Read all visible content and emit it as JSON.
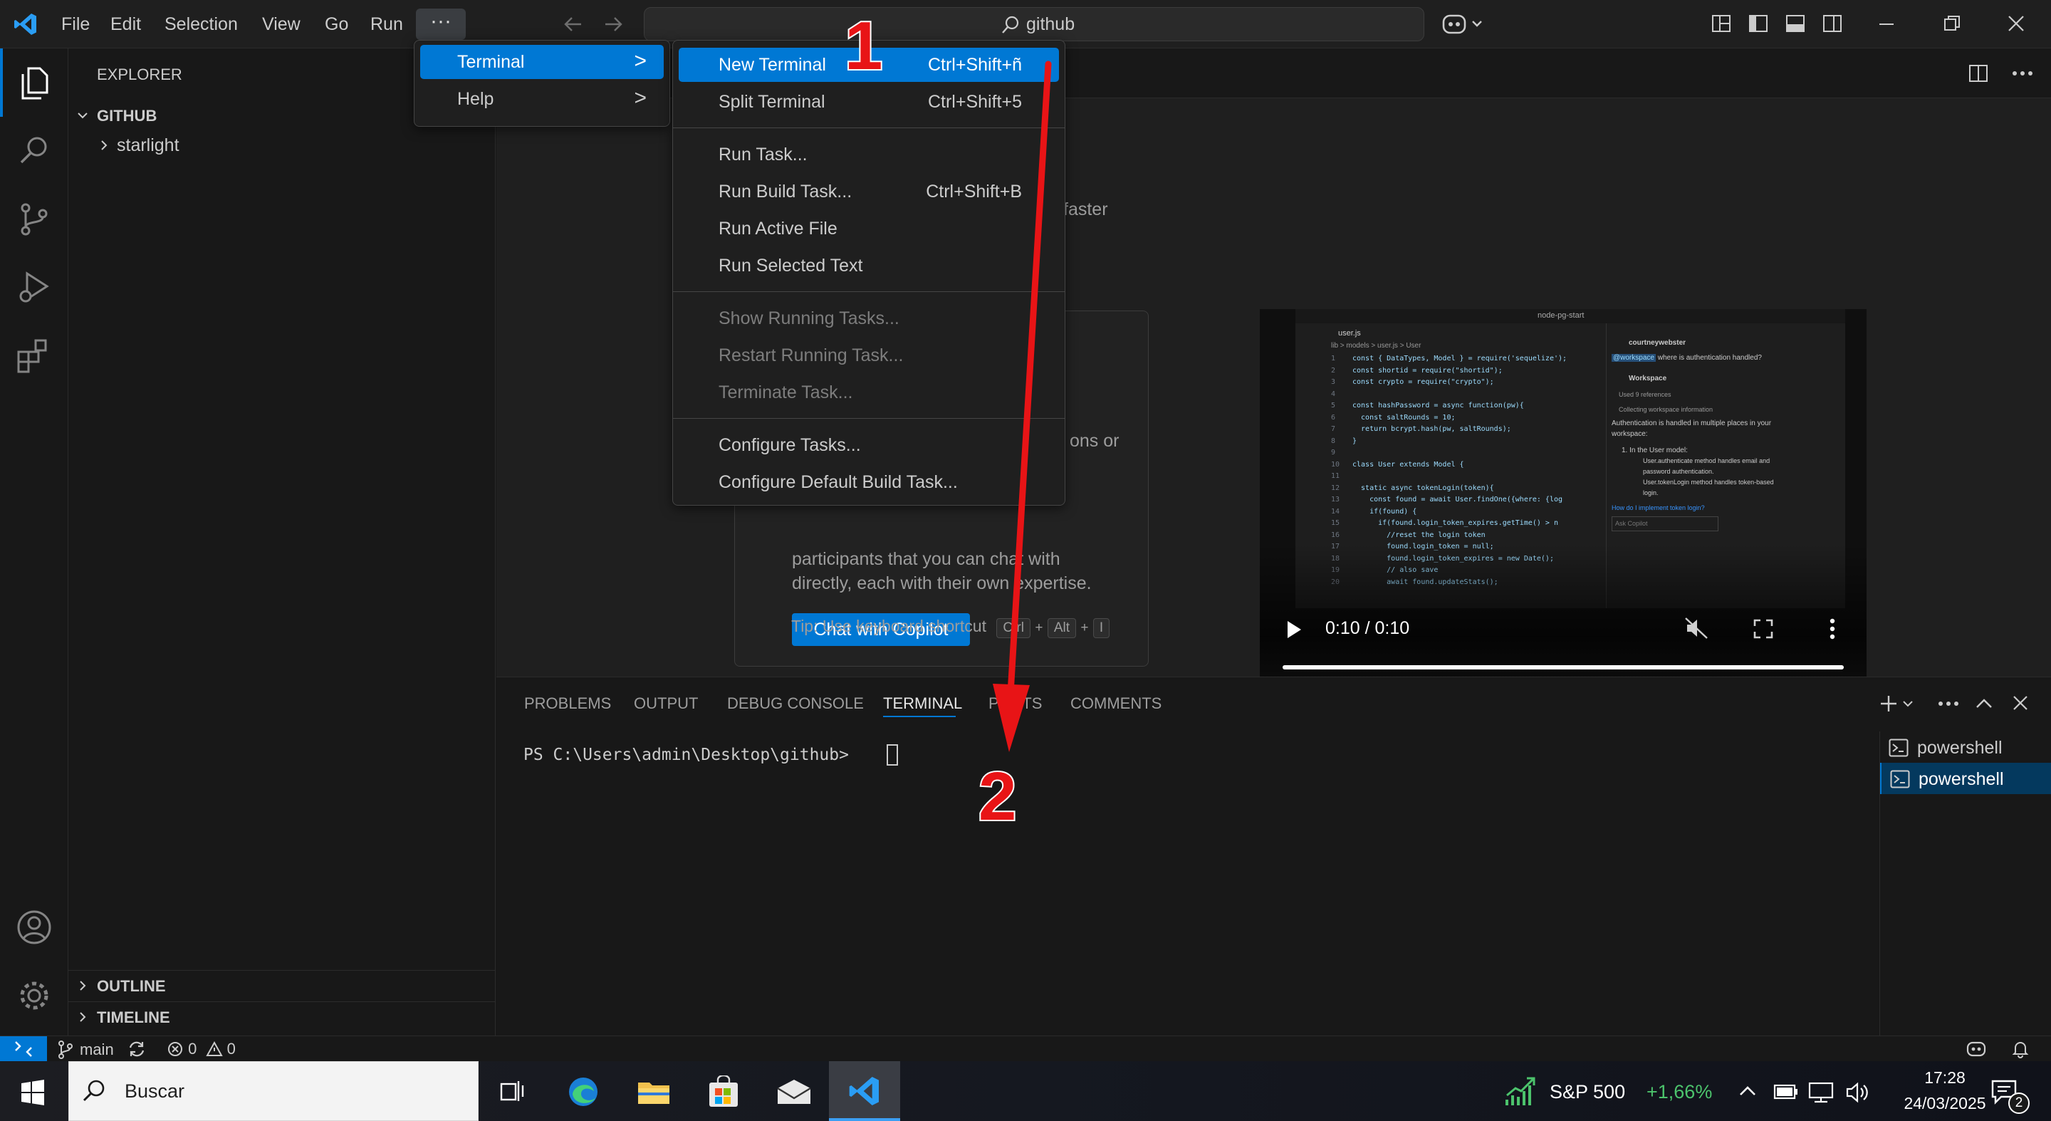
{
  "titlebar": {
    "menus": [
      "File",
      "Edit",
      "Selection",
      "View",
      "Go",
      "Run"
    ],
    "more_label": "···",
    "search_text": "github"
  },
  "sidebar": {
    "title": "EXPLORER",
    "folder": "GITHUB",
    "items": [
      "starlight"
    ],
    "outline": "OUTLINE",
    "timeline": "TIMELINE"
  },
  "top_menu": {
    "items": [
      {
        "label": "Terminal",
        "arrow": ">"
      },
      {
        "label": "Help",
        "arrow": ">"
      }
    ]
  },
  "terminal_menu": {
    "group1": [
      {
        "label": "New Terminal",
        "shortcut": "Ctrl+Shift+ñ"
      },
      {
        "label": "Split Terminal",
        "shortcut": "Ctrl+Shift+5"
      }
    ],
    "group2": [
      {
        "label": "Run Task...",
        "shortcut": ""
      },
      {
        "label": "Run Build Task...",
        "shortcut": "Ctrl+Shift+B"
      },
      {
        "label": "Run Active File",
        "shortcut": ""
      },
      {
        "label": "Run Selected Text",
        "shortcut": ""
      }
    ],
    "group3": [
      {
        "label": "Show Running Tasks..."
      },
      {
        "label": "Restart Running Task..."
      },
      {
        "label": "Terminate Task..."
      }
    ],
    "group4": [
      {
        "label": "Configure Tasks..."
      },
      {
        "label": "Configure Default Build Task..."
      }
    ]
  },
  "welcome": {
    "faster_fragment": "faster",
    "ons_or_fragment": "ons or",
    "participants_line1": "participants that you can chat with",
    "participants_line2": "directly, each with their own expertise.",
    "chat_button": "Chat with Copilot",
    "tip_text": "Tip: Use keyboard shortcut",
    "key1": "Ctrl",
    "plus1": "+",
    "key2": "Alt",
    "plus2": "+",
    "key3": "I"
  },
  "video": {
    "time": "0:10 / 0:10",
    "progress": 1.0,
    "thumb": {
      "search": "node-pg-start",
      "file_tab": "user.js",
      "breadcrumb": "lib > models > user.js > User",
      "code_lines": [
        "const { DataTypes, Model } = require('sequelize');",
        "const shortid = require(\"shortid\");",
        "const crypto = require(\"crypto\");",
        "",
        "const hashPassword = async function(pw){",
        "  const saltRounds = 10;",
        "  return bcrypt.hash(pw, saltRounds);",
        "}",
        "",
        "class User extends Model {",
        "",
        "  static async tokenLogin(token){",
        "    const found = await User.findOne({where: {log",
        "    if(found) {",
        "      if(found.login_token_expires.getTime() > n",
        "        //reset the login token",
        "        found.login_token = null;",
        "        found.login_token_expires = new Date();",
        "        // also save",
        "        await found.updateStats();"
      ],
      "chat_user": "courtneywebster",
      "chat_tag": "@workspace",
      "chat_question": "where is authentication handled?",
      "chat_section": "Workspace",
      "chat_refs": "Used 9 references",
      "chat_collect": "Collecting workspace information",
      "chat_answer1": "Authentication is handled in multiple places in your",
      "chat_answer2": "workspace:",
      "chat_point": "1. In the User model:",
      "chat_sub1": "User.authenticate method handles email and",
      "chat_sub1b": "password authentication.",
      "chat_sub2": "User.tokenLogin method handles token-based",
      "chat_sub2b": "login.",
      "chat_followup": "How do I implement token login?",
      "chat_input": "Ask Copilot"
    }
  },
  "panel": {
    "tabs": [
      "PROBLEMS",
      "OUTPUT",
      "DEBUG CONSOLE",
      "TERMINAL",
      "PORTS",
      "COMMENTS"
    ],
    "active_tab": "TERMINAL",
    "prompt": "PS C:\\Users\\admin\\Desktop\\github>",
    "terminals": [
      "powershell",
      "powershell"
    ]
  },
  "annotations": {
    "num1": "1",
    "num2": "2",
    "color": "#e81416"
  },
  "statusbar": {
    "branch": "main",
    "errors": "0",
    "warnings": "0"
  },
  "taskbar": {
    "search_placeholder": "Buscar",
    "stock_name": "S&P 500",
    "stock_change": "+1,66%",
    "time": "17:28",
    "date": "24/03/2025",
    "notif_count": "2"
  },
  "colors": {
    "accent": "#0078d4",
    "bg": "#1f1f1f",
    "stock_green": "#4cc36c"
  }
}
